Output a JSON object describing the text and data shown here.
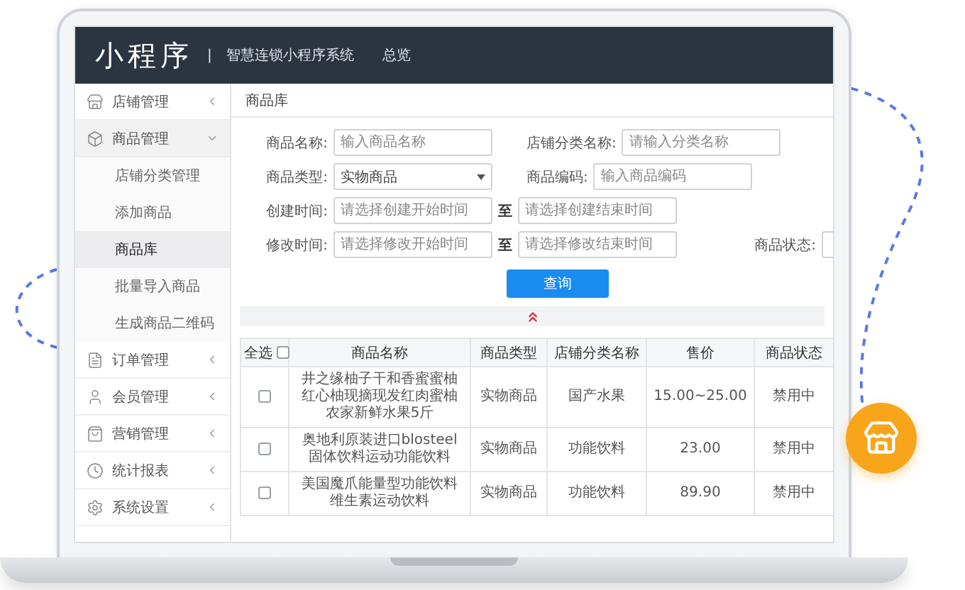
{
  "header": {
    "logo": "小程序",
    "divider": "|",
    "subtitle": "智慧连锁小程序系统",
    "nav": "总览"
  },
  "sidebar": {
    "items": [
      {
        "label": "店铺管理",
        "expanded": false
      },
      {
        "label": "商品管理",
        "expanded": true,
        "children": [
          {
            "label": "店铺分类管理",
            "selected": false
          },
          {
            "label": "添加商品",
            "selected": false
          },
          {
            "label": "商品库",
            "selected": true
          },
          {
            "label": "批量导入商品",
            "selected": false
          },
          {
            "label": "生成商品二维码",
            "selected": false
          }
        ]
      },
      {
        "label": "订单管理",
        "expanded": false
      },
      {
        "label": "会员管理",
        "expanded": false
      },
      {
        "label": "营销管理",
        "expanded": false
      },
      {
        "label": "统计报表",
        "expanded": false
      },
      {
        "label": "系统设置",
        "expanded": false
      }
    ]
  },
  "breadcrumb": "商品库",
  "form": {
    "rows": [
      {
        "fields": [
          {
            "kind": "input",
            "label": "商品名称:",
            "placeholder": "输入商品名称"
          },
          {
            "kind": "input",
            "label": "店铺分类名称:",
            "placeholder": "请输入分类名称"
          }
        ]
      },
      {
        "fields": [
          {
            "kind": "select",
            "label": "商品类型:",
            "value": "实物商品"
          },
          {
            "kind": "input",
            "label": "商品编码:",
            "placeholder": "输入商品编码"
          }
        ]
      },
      {
        "fields": [
          {
            "kind": "range",
            "label": "创建时间:",
            "placeholder": "请选择创建开始时间",
            "separator": "至",
            "placeholder_end": "请选择创建结束时间"
          }
        ]
      },
      {
        "fields": [
          {
            "kind": "range",
            "label": "修改时间:",
            "placeholder": "请选择修改开始时间",
            "separator": "至",
            "placeholder_end": "请选择修改结束时间"
          },
          {
            "kind": "cut",
            "label": "商品状态:"
          }
        ]
      }
    ],
    "button": "查询"
  },
  "table": {
    "select_all": {
      "label": "全选",
      "checked": false
    },
    "columns": [
      "商品名称",
      "商品类型",
      "店铺分类名称",
      "售价",
      "商品状态"
    ],
    "rows": [
      {
        "checked": false,
        "cells": [
          "井之缘柚子干和香蜜蜜柚红心柚现摘现发红肉蜜柚农家新鲜水果5斤",
          "实物商品",
          "国产水果",
          "15.00~25.00",
          "禁用中"
        ]
      },
      {
        "checked": false,
        "cells": [
          "奥地利原装进口blosteel固体饮料运动功能饮料",
          "实物商品",
          "功能饮料",
          "23.00",
          "禁用中"
        ]
      },
      {
        "checked": false,
        "cells": [
          "美国魔爪能量型功能饮料维生素运动饮料",
          "实物商品",
          "功能饮料",
          "89.90",
          "禁用中"
        ]
      }
    ]
  }
}
